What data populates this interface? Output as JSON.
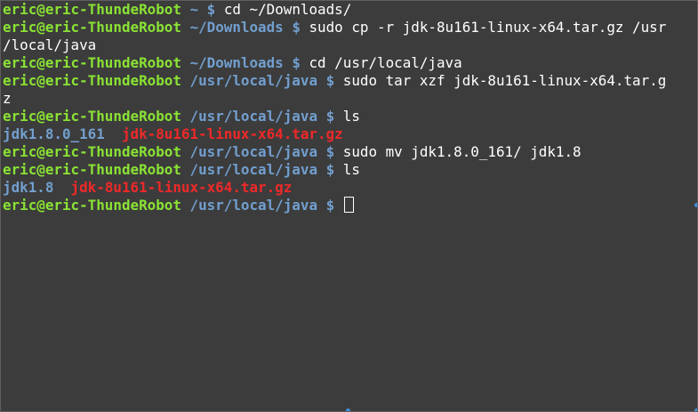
{
  "terminal": {
    "lines": [
      {
        "user": "eric@eric-ThundeRobot",
        "path": "~",
        "prompt": "$",
        "command": "cd ~/Downloads/"
      },
      {
        "user": "eric@eric-ThundeRobot",
        "path": "~/Downloads",
        "prompt": "$",
        "command": "sudo cp -r jdk-8u161-linux-x64.tar.gz /usr"
      },
      {
        "text": "/local/java"
      },
      {
        "user": "eric@eric-ThundeRobot",
        "path": "~/Downloads",
        "prompt": "$",
        "command": "cd /usr/local/java"
      },
      {
        "user": "eric@eric-ThundeRobot",
        "path": "/usr/local/java",
        "prompt": "$",
        "command": "sudo tar xzf jdk-8u161-linux-x64.tar.g"
      },
      {
        "text": "z"
      },
      {
        "user": "eric@eric-ThundeRobot",
        "path": "/usr/local/java",
        "prompt": "$",
        "command": "ls"
      },
      {
        "dir": "jdk1.8.0_161",
        "archive": "jdk-8u161-linux-x64.tar.gz"
      },
      {
        "user": "eric@eric-ThundeRobot",
        "path": "/usr/local/java",
        "prompt": "$",
        "command": "sudo mv jdk1.8.0_161/ jdk1.8"
      },
      {
        "user": "eric@eric-ThundeRobot",
        "path": "/usr/local/java",
        "prompt": "$",
        "command": "ls"
      },
      {
        "dir": "jdk1.8",
        "archive": "jdk-8u161-linux-x64.tar.gz"
      },
      {
        "user": "eric@eric-ThundeRobot",
        "path": "/usr/local/java",
        "prompt": "$",
        "command": ""
      }
    ]
  },
  "colors": {
    "background": "#3c3c3c",
    "user_host": "#8ae234",
    "path": "#729fcf",
    "directory": "#729fcf",
    "archive": "#ef2929",
    "text": "#ffffff"
  }
}
